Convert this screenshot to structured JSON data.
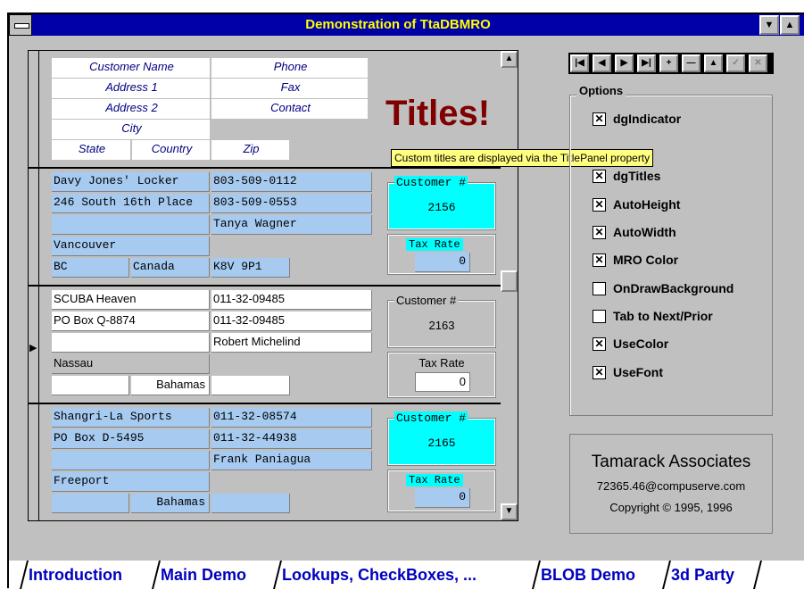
{
  "window": {
    "title": "Demonstration of TtaDBMRO",
    "min_icon": "▼",
    "max_icon": "▲"
  },
  "grid": {
    "title_panel": {
      "customer_name": "Customer Name",
      "address1": "Address 1",
      "address2": "Address 2",
      "city": "City",
      "state": "State",
      "country": "Country",
      "phone": "Phone",
      "fax": "Fax",
      "contact": "Contact",
      "zip": "Zip",
      "big_title": "Titles!"
    },
    "hint": "Custom titles are displayed via the TitlePanel property",
    "records": [
      {
        "name": "Davy Jones' Locker",
        "addr1": "246 South 16th Place",
        "addr2": "",
        "city": "Vancouver",
        "state": "BC",
        "country": "Canada",
        "phone": "803-509-0112",
        "fax": "803-509-0553",
        "contact": "Tanya Wagner",
        "zip": "K8V 9P1",
        "customer_label": "Customer #",
        "customer_no": "2156",
        "tax_label": "Tax Rate",
        "tax": "0"
      },
      {
        "name": "SCUBA Heaven",
        "addr1": "PO Box Q-8874",
        "addr2": "",
        "city": "Nassau",
        "state": "",
        "country": "Bahamas",
        "phone": "011-32-09485",
        "fax": "011-32-09485",
        "contact": "Robert Michelind",
        "zip": "",
        "customer_label": "Customer #",
        "customer_no": "2163",
        "tax_label": "Tax Rate",
        "tax": "0"
      },
      {
        "name": "Shangri-La Sports",
        "addr1": "PO Box D-5495",
        "addr2": "",
        "city": "Freeport",
        "state": "",
        "country": "Bahamas",
        "phone": "011-32-08574",
        "fax": "011-32-44938",
        "contact": "Frank Paniagua",
        "zip": "",
        "customer_label": "Customer #",
        "customer_no": "2165",
        "tax_label": "Tax Rate",
        "tax": "0"
      }
    ],
    "current_indicator": "▶"
  },
  "navigator": {
    "buttons": [
      "|◀",
      "◀",
      "▶",
      "▶|",
      "+",
      "—",
      "▲",
      "✓",
      "✕"
    ]
  },
  "options": {
    "label": "Options",
    "items": [
      {
        "label": "dgIndicator",
        "checked": true
      },
      {
        "label": "dgTitles",
        "checked": true
      },
      {
        "label": "AutoHeight",
        "checked": true
      },
      {
        "label": "AutoWidth",
        "checked": true
      },
      {
        "label": "MRO Color",
        "checked": true
      },
      {
        "label": "OnDrawBackground",
        "checked": false
      },
      {
        "label": "Tab to Next/Prior",
        "checked": false
      },
      {
        "label": "UseColor",
        "checked": true
      },
      {
        "label": "UseFont",
        "checked": true
      }
    ]
  },
  "about": {
    "company": "Tamarack Associates",
    "email": "72365.46@compuserve.com",
    "copyright": "Copyright © 1995, 1996"
  },
  "tabs": [
    {
      "label": "Introduction",
      "active": false
    },
    {
      "label": "Main Demo",
      "active": true
    },
    {
      "label": "Lookups, CheckBoxes, ...",
      "active": false
    },
    {
      "label": "BLOB Demo",
      "active": false
    },
    {
      "label": "3d Party",
      "active": false
    }
  ],
  "colors": {
    "title_bar": "#0000a8",
    "title_text": "#ffff00",
    "highlight_cells": "#a6caf0",
    "customer_highlight": "#00ffff",
    "titles_text": "#800000"
  }
}
